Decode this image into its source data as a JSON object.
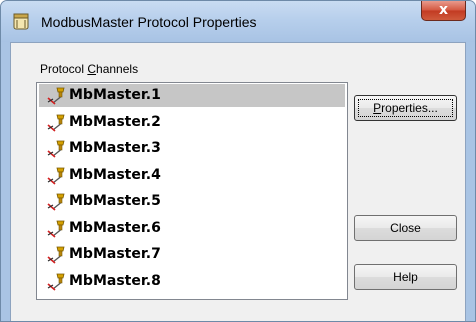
{
  "window": {
    "title": "ModbusMaster Protocol Properties",
    "close_glyph": "x"
  },
  "group": {
    "label_pre": "Protocol ",
    "label_accel": "C",
    "label_post": "hannels"
  },
  "channels": [
    {
      "label": "MbMaster.1",
      "icon": "channel-plug-icon",
      "selected": true
    },
    {
      "label": "MbMaster.2",
      "icon": "channel-plug-icon",
      "selected": false
    },
    {
      "label": "MbMaster.3",
      "icon": "channel-plug-icon",
      "selected": false
    },
    {
      "label": "MbMaster.4",
      "icon": "channel-plug-icon",
      "selected": false
    },
    {
      "label": "MbMaster.5",
      "icon": "channel-plug-icon",
      "selected": false
    },
    {
      "label": "MbMaster.6",
      "icon": "channel-plug-icon",
      "selected": false
    },
    {
      "label": "MbMaster.7",
      "icon": "channel-plug-icon",
      "selected": false
    },
    {
      "label": "MbMaster.8",
      "icon": "channel-plug-icon",
      "selected": false
    }
  ],
  "buttons": {
    "properties_accel": "P",
    "properties_rest": "roperties...",
    "close": "Close",
    "help": "Help"
  },
  "colors": {
    "selection": "#c6c6c6",
    "title_bar": "#b7cfec",
    "close_button": "#c23a22"
  }
}
